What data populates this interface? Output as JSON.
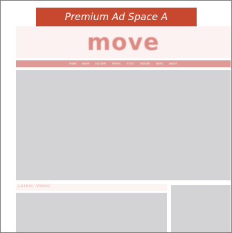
{
  "ad": {
    "label": "Premium Ad Space A"
  },
  "site": {
    "logo_text": "move"
  },
  "nav": {
    "items": [
      "HOME",
      "NEWS",
      "CULTURE",
      "TRAVEL",
      "STYLE",
      "LEISURE",
      "MUSIC",
      "ABOUT"
    ]
  },
  "section": {
    "label": "LATEST VIDEO"
  },
  "colors": {
    "ad_banner": "#c8472f",
    "logo": "#dc8a84",
    "nav_bar": "#e09a96",
    "placeholder": "#d3d3d5"
  }
}
